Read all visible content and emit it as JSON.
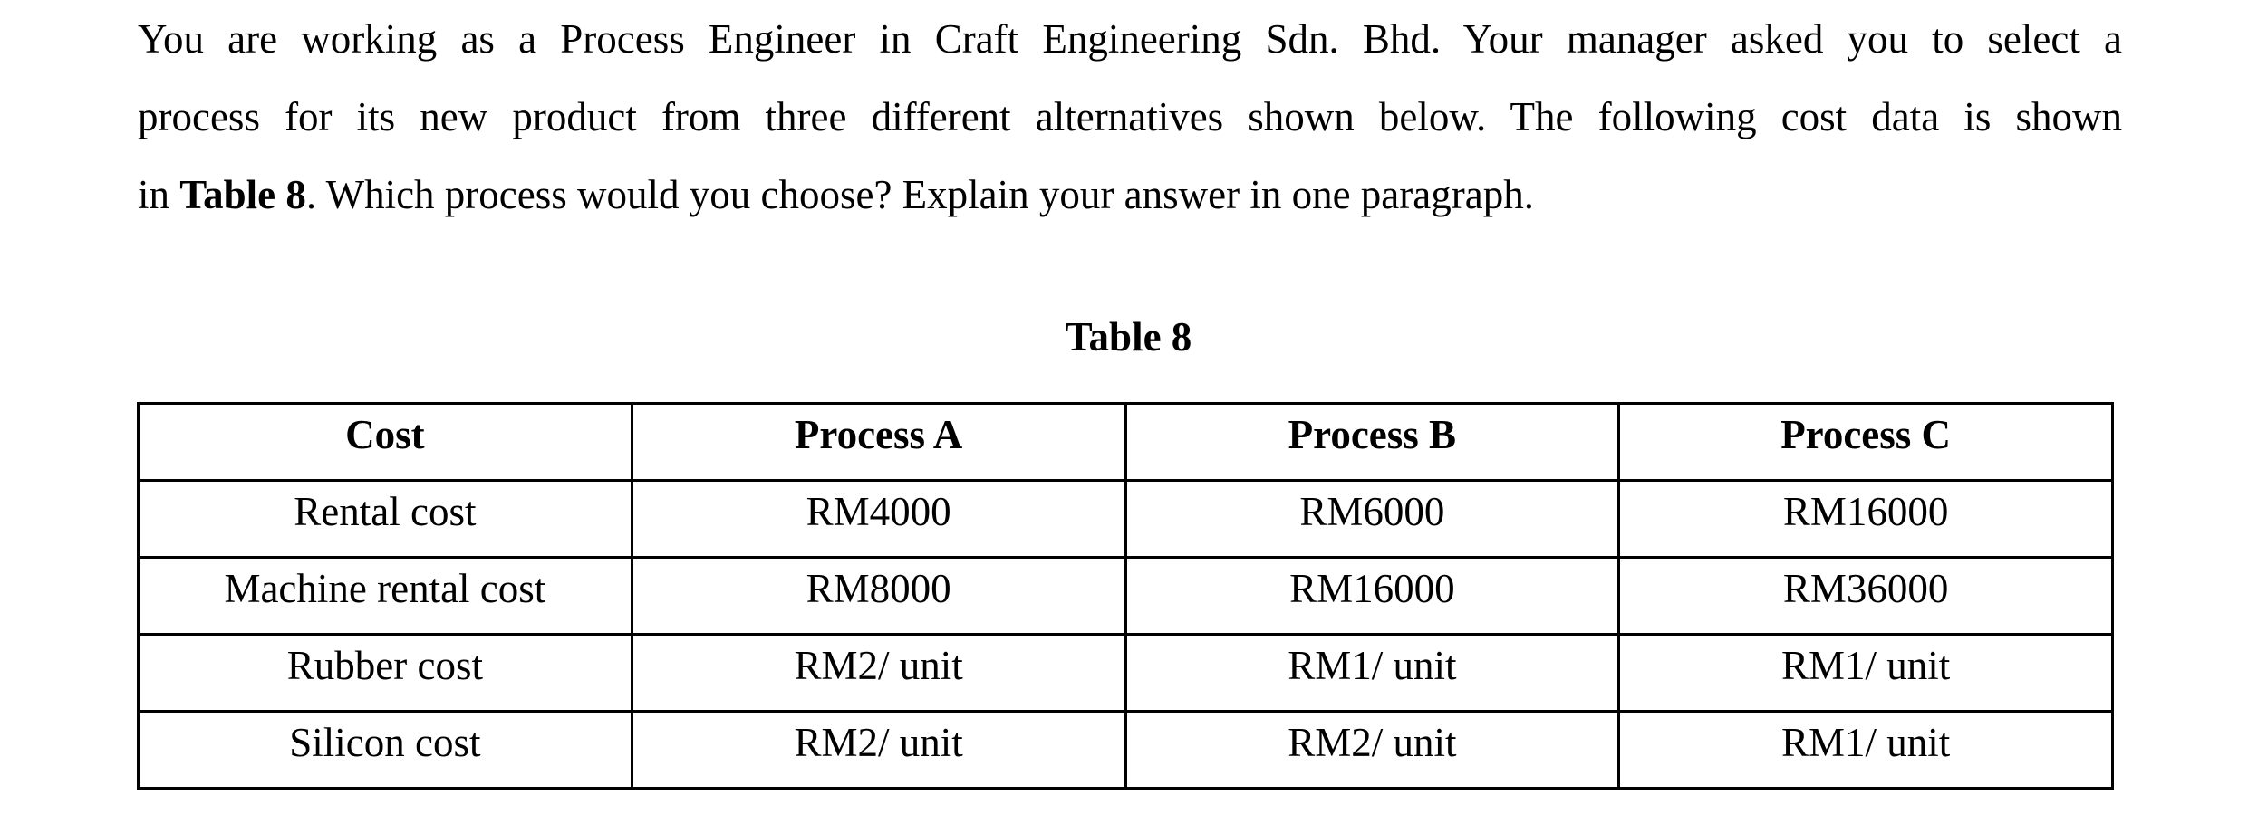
{
  "question": {
    "lines": [
      "You are working as a Process Engineer in Craft Engineering Sdn. Bhd.  Your manager asked you to select a",
      "process for its new product from three different alternatives shown below.  The following cost data is shown"
    ],
    "last_line_prefix": "in ",
    "last_line_bold": "Table 8",
    "last_line_suffix": ".  Which process would you choose?  Explain your answer in one paragraph."
  },
  "table": {
    "caption": "Table 8",
    "headers": [
      "Cost",
      "Process A",
      "Process B",
      "Process C"
    ],
    "rows": [
      [
        "Rental cost",
        "RM4000",
        "RM6000",
        "RM16000"
      ],
      [
        "Machine rental cost",
        "RM8000",
        "RM16000",
        "RM36000"
      ],
      [
        "Rubber cost",
        "RM2/ unit",
        "RM1/ unit",
        "RM1/ unit"
      ],
      [
        "Silicon cost",
        "RM2/ unit",
        "RM2/ unit",
        "RM1/ unit"
      ]
    ]
  }
}
